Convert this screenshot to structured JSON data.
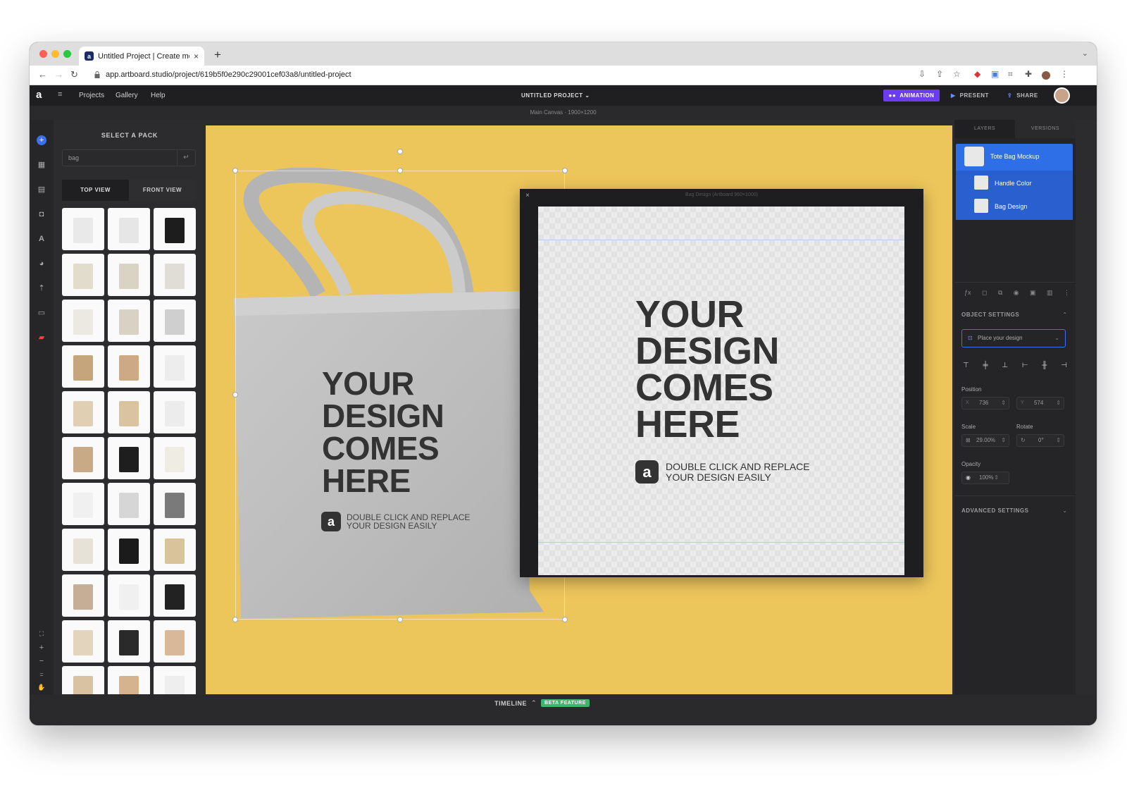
{
  "browser": {
    "tab_title": "Untitled Project | Create mock",
    "tab_favicon": "a",
    "new_tab": "+",
    "url": "app.artboard.studio/project/619b5f0e290c29001cef03a8/untitled-project"
  },
  "app": {
    "logo": "a",
    "menu": [
      "Projects",
      "Gallery",
      "Help"
    ],
    "project_title": "UNTITLED PROJECT",
    "animation_label": "ANIMATION",
    "present_label": "PRESENT",
    "share_label": "SHARE",
    "canvas_info": "Main Canvas · 1900×1200"
  },
  "left_panel": {
    "title": "SELECT A PACK",
    "search_value": "bag",
    "tabs": [
      "TOP VIEW",
      "FRONT VIEW"
    ]
  },
  "canvas": {
    "bg_color": "#ecc55b",
    "bag_text": [
      "YOUR",
      "DESIGN",
      "COMES",
      "HERE"
    ],
    "bag_caption_1": "DOUBLE CLICK AND REPLACE",
    "bag_caption_2": "YOUR DESIGN EASILY",
    "artboard_title": "Bag Design (Artboard 960×1000)",
    "artboard_text": [
      "YOUR",
      "DESIGN",
      "COMES",
      "HERE"
    ],
    "artboard_caption_1": "DOUBLE CLICK AND REPLACE",
    "artboard_caption_2": "YOUR DESIGN EASILY"
  },
  "right_panel": {
    "tabs": [
      "LAYERS",
      "VERSIONS"
    ],
    "layers": [
      {
        "name": "Tote Bag Mockup"
      },
      {
        "name": "Handle Color"
      },
      {
        "name": "Bag Design"
      }
    ],
    "object_settings_label": "OBJECT SETTINGS",
    "place_design": "Place your design",
    "position_label": "Position",
    "x_label": "X",
    "x_value": "736",
    "y_label": "Y",
    "y_value": "574",
    "scale_label": "Scale",
    "scale_value": "29.00%",
    "rotate_label": "Rotate",
    "rotate_value": "0°",
    "opacity_label": "Opacity",
    "opacity_value": "100%",
    "advanced_label": "ADVANCED SETTINGS"
  },
  "bottom": {
    "timeline_label": "TIMELINE",
    "beta_label": "BETA FEATURE"
  },
  "colors": {
    "accent_purple": "#6b3cf0",
    "layer_blue": "#2e6fe8",
    "beta_green": "#3fb56a"
  }
}
